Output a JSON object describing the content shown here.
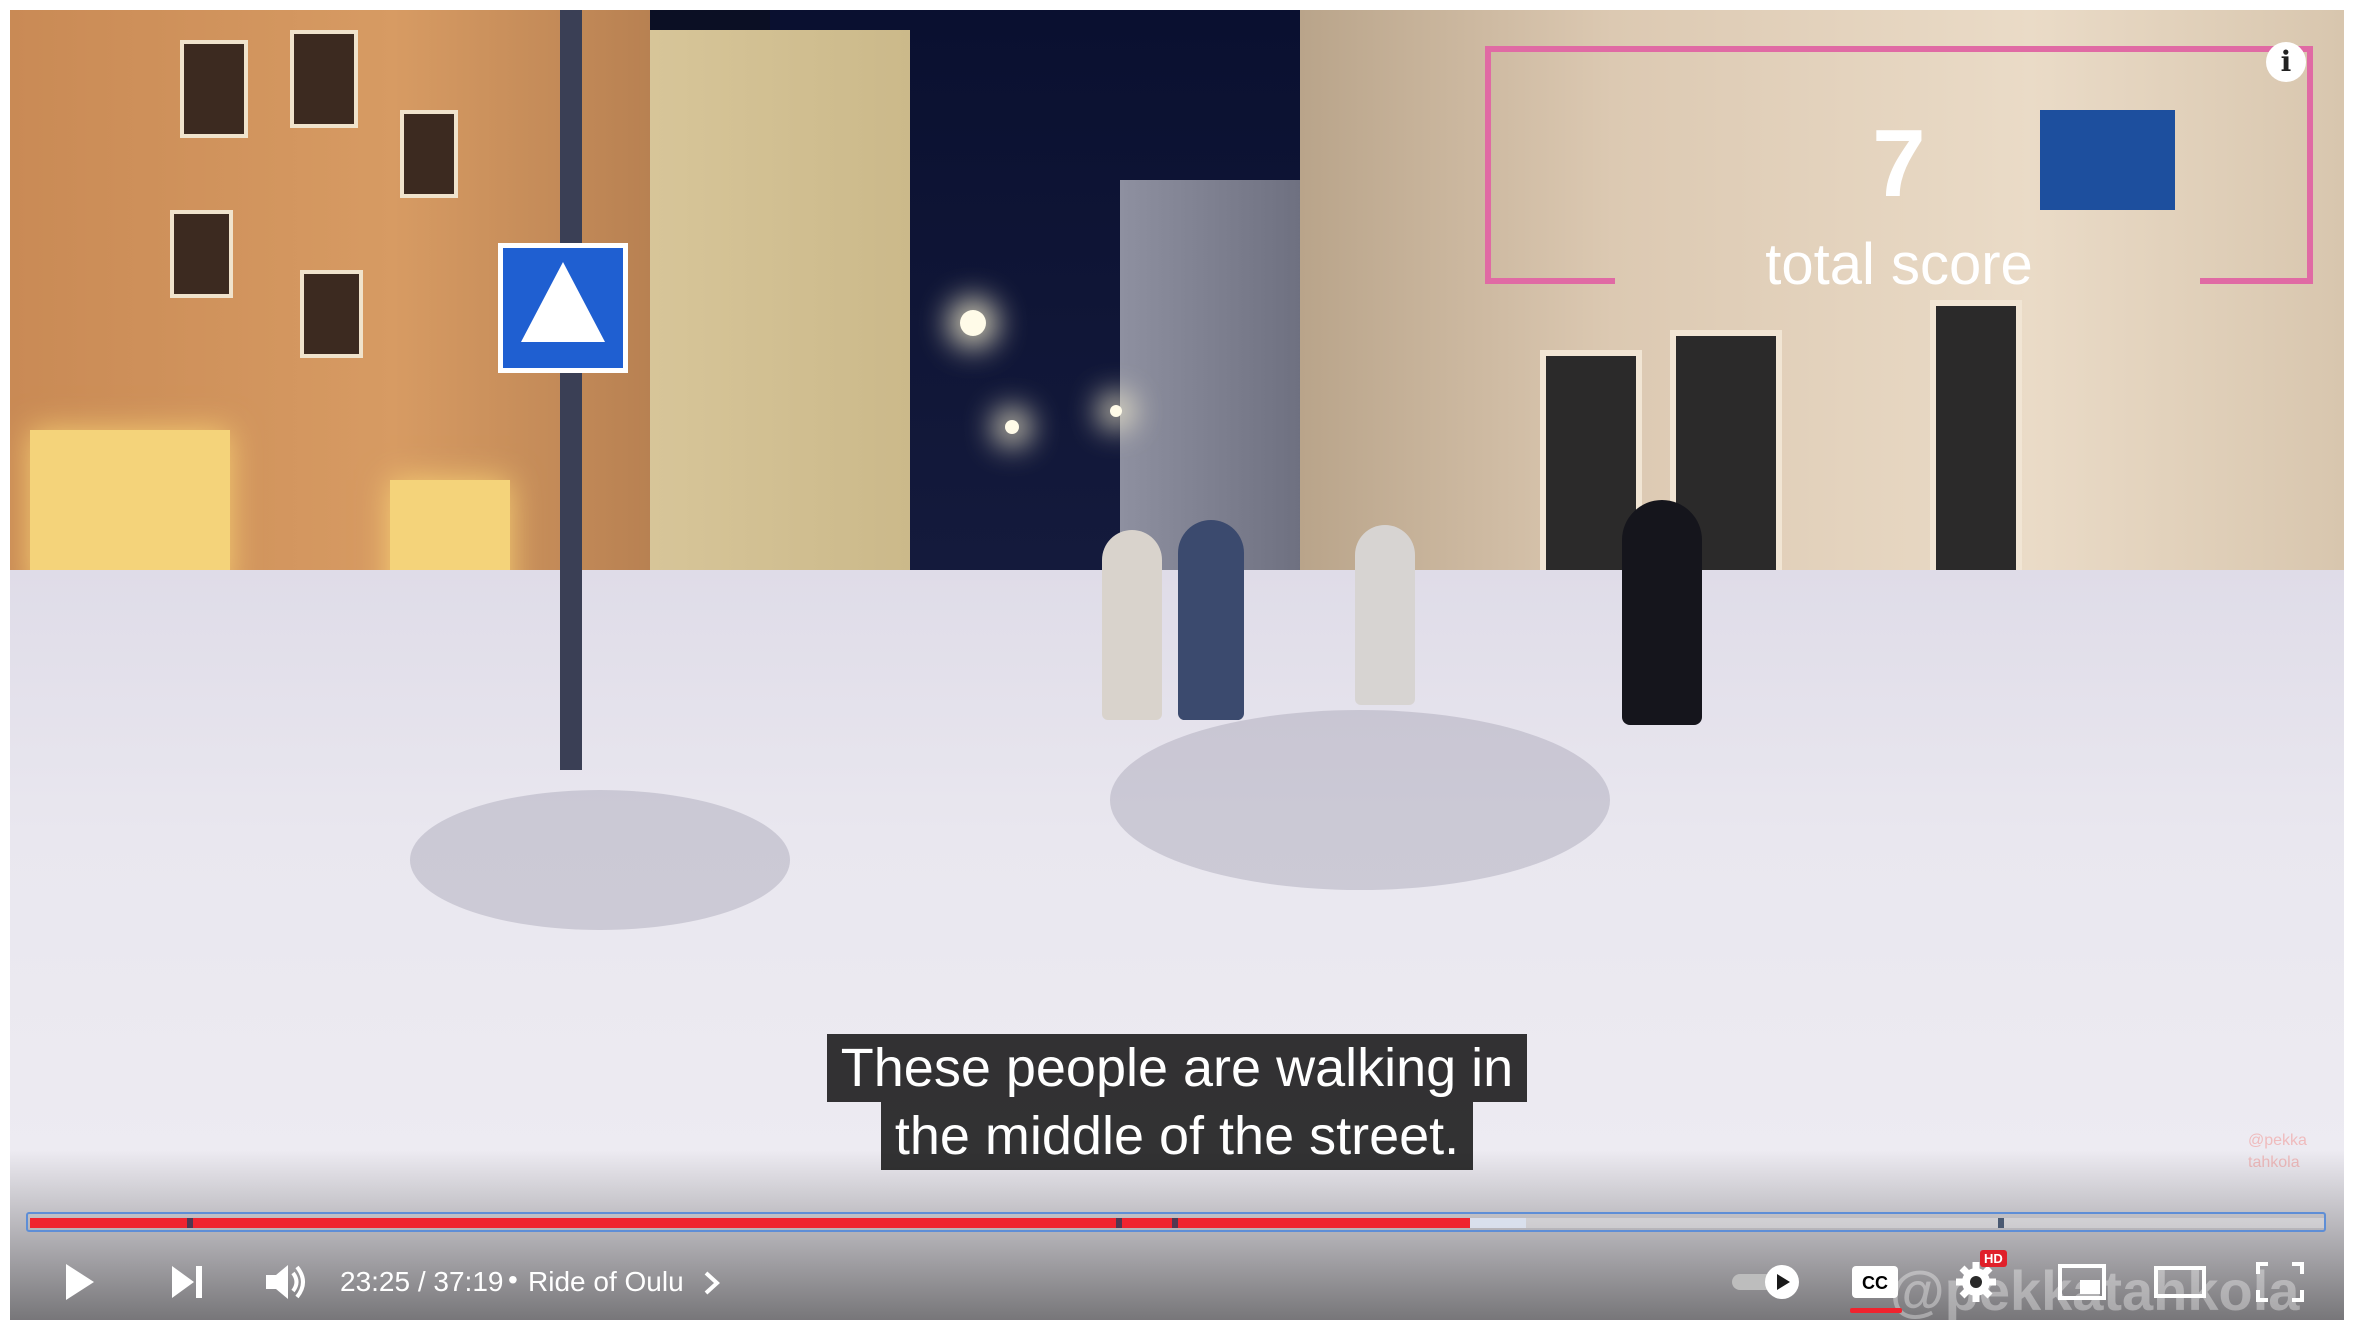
{
  "overlay": {
    "score_value": "7",
    "score_label": "total score",
    "info_icon": "i",
    "small_watermark": "@pekka\ntahkola"
  },
  "captions": {
    "line1": "These people are walking in",
    "line2": "the middle of the street."
  },
  "player": {
    "current_time": "23:25",
    "duration": "37:19",
    "time_display": "23:25 / 37:19",
    "chapter_separator": "•",
    "chapter_title": "Ride of Oulu",
    "corner_watermark": "@pekkatahkola",
    "hd_badge": "HD",
    "progress_played_fraction": 0.6277,
    "progress_buffered_fraction": 0.652,
    "chapter_markers_fraction": [
      0.0685,
      0.4735,
      0.498,
      0.858
    ],
    "autoplay_enabled": true,
    "captions_enabled": true,
    "accent_color": "#f0232e",
    "icons": [
      "play-icon",
      "next-icon",
      "volume-icon",
      "chevron-right-icon",
      "autoplay-toggle-icon",
      "captions-icon",
      "settings-icon",
      "miniplayer-icon",
      "theater-icon",
      "fullscreen-icon"
    ]
  }
}
